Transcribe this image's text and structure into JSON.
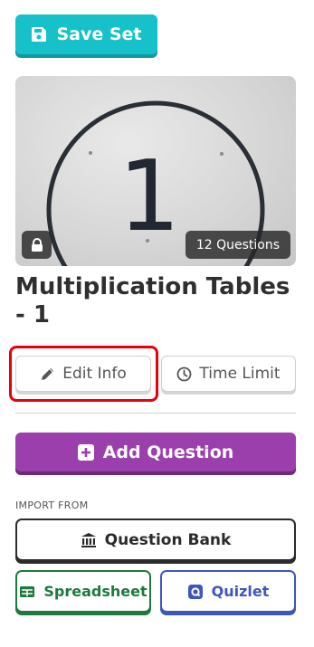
{
  "toolbar": {
    "save_label": "Save Set"
  },
  "set": {
    "cover_number": "1",
    "question_count": "12 Questions",
    "title": "Multiplication Tables - 1"
  },
  "actions": {
    "edit_info_label": "Edit Info",
    "time_limit_label": "Time Limit",
    "add_question_label": "Add Question"
  },
  "import": {
    "heading": "IMPORT FROM",
    "question_bank_label": "Question Bank",
    "spreadsheet_label": "Spreadsheet",
    "quizlet_label": "Quizlet"
  },
  "colors": {
    "save_accent": "#16c1c9",
    "add_accent": "#9b3fad",
    "highlight": "#e8000b",
    "spreadsheet": "#1d7a3c",
    "quizlet": "#3d57bd"
  },
  "icons": {
    "save": "floppy-disk-icon",
    "lock": "lock-icon",
    "edit": "pencil-icon",
    "time": "clock-icon",
    "add": "plus-square-icon",
    "bank": "bank-icon",
    "sheet": "table-icon",
    "quizlet": "quizlet-icon"
  }
}
